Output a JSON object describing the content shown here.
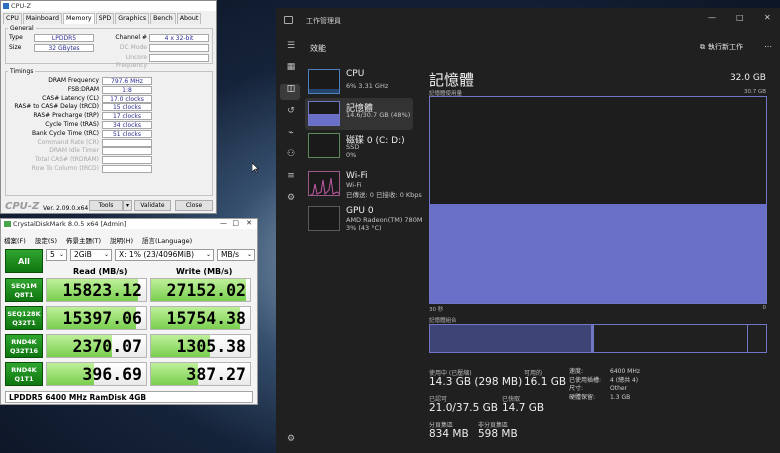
{
  "cpuz": {
    "title": "CPU-Z",
    "tabs": [
      "CPU",
      "Mainboard",
      "Memory",
      "SPD",
      "Graphics",
      "Bench",
      "About"
    ],
    "general_label": "General",
    "type_label": "Type",
    "type": "LPDDR5",
    "size_label": "Size",
    "size": "32 GBytes",
    "channel_label": "Channel #",
    "channel": "4 x 32-bit",
    "dcmode_label": "DC Mode",
    "uncore_label": "Uncore Frequency",
    "timings_label": "Timings",
    "timings": [
      {
        "label": "DRAM Frequency",
        "value": "797.6 MHz"
      },
      {
        "label": "FSB:DRAM",
        "value": "1:8"
      },
      {
        "label": "CAS# Latency (CL)",
        "value": "17.0 clocks"
      },
      {
        "label": "RAS# to CAS# Delay (tRCD)",
        "value": "15 clocks"
      },
      {
        "label": "RAS# Precharge (tRP)",
        "value": "17 clocks"
      },
      {
        "label": "Cycle Time (tRAS)",
        "value": "34 clocks"
      },
      {
        "label": "Bank Cycle Time (tRC)",
        "value": "51 clocks"
      },
      {
        "label": "Command Rate (CR)",
        "value": ""
      },
      {
        "label": "DRAM Idle Timer",
        "value": ""
      },
      {
        "label": "Total CAS# (tRDRAM)",
        "value": ""
      },
      {
        "label": "Row To Column (tRCD)",
        "value": ""
      }
    ],
    "brand": "CPU-Z",
    "version": "Ver. 2.09.0.x64",
    "tools": "Tools",
    "validate": "Validate",
    "close": "Close"
  },
  "cdm": {
    "title": "CrystalDiskMark 8.0.5 x64 [Admin]",
    "menu": [
      "檔案(F)",
      "設定(S)",
      "佈景主題(T)",
      "說明(H)",
      "語言(Language)"
    ],
    "all": "All",
    "count": "5",
    "size": "2GiB",
    "drive": "X: 1% (23/4096MiB)",
    "unit": "MB/s",
    "read_header": "Read (MB/s)",
    "write_header": "Write (MB/s)",
    "rows": [
      {
        "l1": "SEQ1M",
        "l2": "Q8T1",
        "read": "15823.12",
        "write": "27152.02",
        "read_pct": 0.92,
        "write_pct": 0.96
      },
      {
        "l1": "SEQ128K",
        "l2": "Q32T1",
        "read": "15397.06",
        "write": "15754.38",
        "read_pct": 0.9,
        "write_pct": 0.9
      },
      {
        "l1": "RND4K",
        "l2": "Q32T16",
        "read": "2370.07",
        "write": "1305.38",
        "read_pct": 0.66,
        "write_pct": 0.6
      },
      {
        "l1": "RND4K",
        "l2": "Q1T1",
        "read": "396.69",
        "write": "387.27",
        "read_pct": 0.47,
        "write_pct": 0.47
      }
    ],
    "footer": "LPDDR5 6400 MHz RamDisk 4GB"
  },
  "tm": {
    "title": "工作管理員",
    "section": "效能",
    "run_task": "執行新工作",
    "items": [
      {
        "name": "CPU",
        "sub1": "6%  3.31 GHz",
        "sub2": ""
      },
      {
        "name": "記憶體",
        "sub1": "14.6/30.7 GB (48%)",
        "sub2": ""
      },
      {
        "name": "磁碟 0 (C: D:)",
        "sub1": "SSD",
        "sub2": "0%"
      },
      {
        "name": "Wi-Fi",
        "sub1": "Wi-Fi",
        "sub2": "已傳送: 0 已接收: 0 Kbps"
      },
      {
        "name": "GPU 0",
        "sub1": "AMD Radeon(TM) 780M",
        "sub2": "3% (43 °C)"
      }
    ],
    "mem_title": "記憶體",
    "mem_total": "32.0 GB",
    "usage_label": "記憶體使用量",
    "usage_max": "30.7 GB",
    "time_label": "30 秒",
    "zero_label": "0",
    "composition_label": "記憶體組合",
    "in_use_fraction": 0.48,
    "stats": {
      "in_use_label": "使用中 (已壓縮)",
      "in_use": "14.3 GB (298 MB)",
      "available_label": "可用的",
      "available": "16.1 GB",
      "committed_label": "已認可",
      "committed": "21.0/37.5 GB",
      "cached_label": "已快取",
      "cached": "14.7 GB",
      "paged_label": "分頁集區",
      "paged": "834 MB",
      "nonpaged_label": "非分頁集區",
      "nonpaged": "598 MB"
    },
    "details": [
      {
        "k": "速度:",
        "v": "6400 MHz"
      },
      {
        "k": "已使用插槽:",
        "v": "4 (總共 4)"
      },
      {
        "k": "尺寸:",
        "v": "Other"
      },
      {
        "k": "硬體保留:",
        "v": "1.3 GB"
      }
    ]
  },
  "colors": {
    "green": "#1f8f1f",
    "accent": "#6a70c8",
    "tm_bg": "#202020"
  }
}
